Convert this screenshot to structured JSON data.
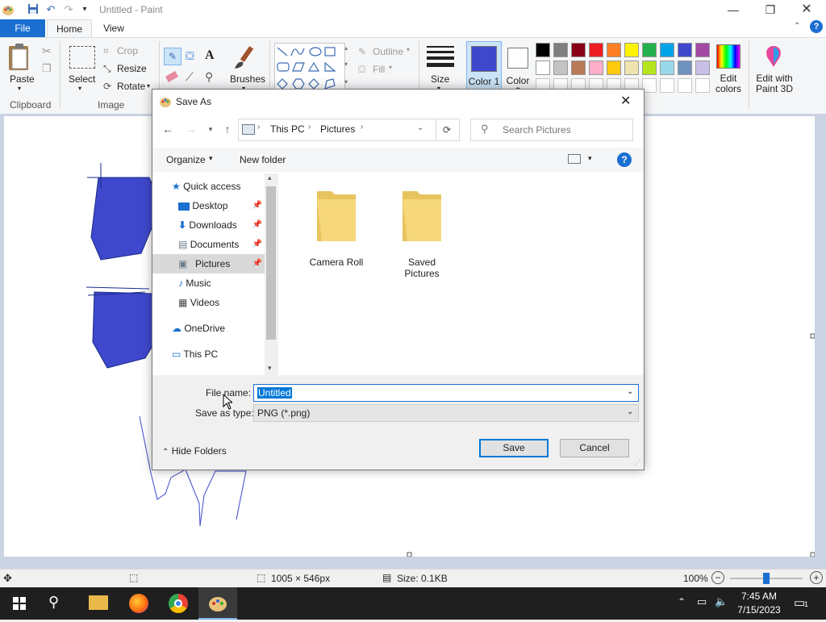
{
  "window": {
    "title": "Untitled - Paint"
  },
  "tabs": {
    "file": "File",
    "home": "Home",
    "view": "View"
  },
  "ribbon": {
    "clipboard": {
      "paste": "Paste",
      "label": "Clipboard"
    },
    "image": {
      "select": "Select",
      "crop": "Crop",
      "resize": "Resize",
      "rotate": "Rotate",
      "label": "Image"
    },
    "tools": {
      "text_tool": "A"
    },
    "brushes": "Brushes",
    "shapes": {
      "outline": "Outline",
      "fill": "Fill"
    },
    "size": "Size",
    "color1": "Color 1",
    "color2": "Color 2",
    "edit_colors": "Edit colors",
    "edit_3d": "Edit with Paint 3D",
    "palette_row1": [
      "#000000",
      "#7f7f7f",
      "#880015",
      "#ed1c24",
      "#ff7f27",
      "#fff200",
      "#22b14c",
      "#00a2e8",
      "#3f48cc",
      "#a349a4"
    ],
    "palette_row2": [
      "#ffffff",
      "#c3c3c3",
      "#b97a57",
      "#ffaec9",
      "#ffc90e",
      "#efe4b0",
      "#b5e61d",
      "#99d9ea",
      "#7092be",
      "#c8bfe7"
    ],
    "color1_value": "#3f48cc"
  },
  "dialog": {
    "title": "Save As",
    "breadcrumb": [
      "This PC",
      "Pictures"
    ],
    "search_placeholder": "Search Pictures",
    "organize": "Organize",
    "new_folder": "New folder",
    "nav": {
      "quick_access": "Quick access",
      "desktop": "Desktop",
      "downloads": "Downloads",
      "documents": "Documents",
      "pictures": "Pictures",
      "music": "Music",
      "videos": "Videos",
      "onedrive": "OneDrive",
      "this_pc": "This PC"
    },
    "folders": [
      "Camera Roll",
      "Saved Pictures"
    ],
    "file_name_label": "File name:",
    "file_name_value": "Untitled",
    "save_as_type_label": "Save as type:",
    "save_as_type_value": "PNG (*.png)",
    "hide_folders": "Hide Folders",
    "save": "Save",
    "cancel": "Cancel"
  },
  "statusbar": {
    "dimensions": "1005 × 546px",
    "size": "Size: 0.1KB",
    "zoom": "100%"
  },
  "taskbar": {
    "time": "7:45 AM",
    "date": "7/15/2023",
    "notifications": "1"
  }
}
